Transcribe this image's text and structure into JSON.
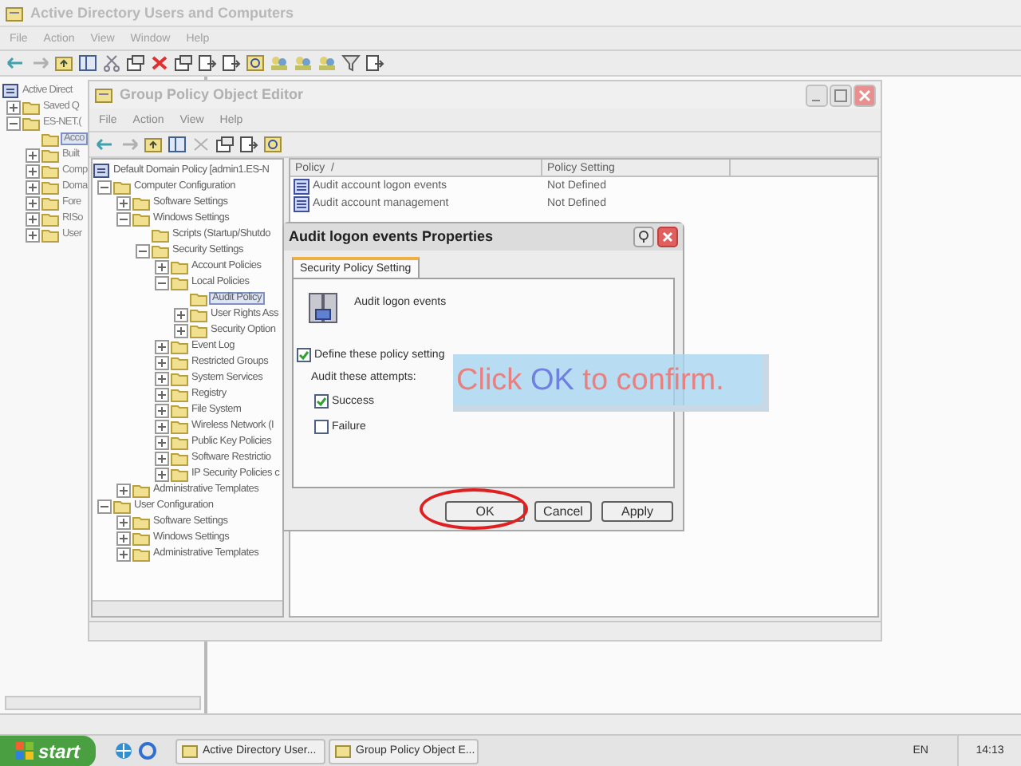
{
  "aduc": {
    "title": "Active Directory Users and Computers",
    "menu": [
      "File",
      "Action",
      "View",
      "Window",
      "Help"
    ],
    "tree": [
      {
        "label": "Active Direct",
        "kind": "root",
        "selected": false,
        "children": [
          {
            "label": "Saved Q",
            "kind": "collapsed",
            "selected": false
          },
          {
            "label": "ES-NET.(",
            "kind": "expanded",
            "selected": false,
            "children": [
              {
                "label": "Acco",
                "kind": "leaf",
                "selected": true
              },
              {
                "label": "Built",
                "kind": "collapsed",
                "selected": false
              },
              {
                "label": "Comp",
                "kind": "collapsed",
                "selected": false
              },
              {
                "label": "Doma",
                "kind": "collapsed",
                "selected": false
              },
              {
                "label": "Fore",
                "kind": "collapsed",
                "selected": false
              },
              {
                "label": "RISo",
                "kind": "collapsed",
                "selected": false
              },
              {
                "label": "User",
                "kind": "collapsed",
                "selected": false
              }
            ]
          }
        ]
      }
    ]
  },
  "gpo": {
    "title": "Group Policy Object Editor",
    "menu": [
      "File",
      "Action",
      "View",
      "Help"
    ],
    "tree": [
      {
        "label": "Default Domain Policy [admin1.ES-N",
        "kind": "root",
        "selected": false,
        "children": [
          {
            "label": "Computer Configuration",
            "kind": "expanded",
            "selected": false,
            "children": [
              {
                "label": "Software Settings",
                "kind": "collapsed",
                "selected": false
              },
              {
                "label": "Windows Settings",
                "kind": "expanded",
                "selected": false,
                "children": [
                  {
                    "label": "Scripts (Startup/Shutdo",
                    "kind": "leaf",
                    "selected": false
                  },
                  {
                    "label": "Security Settings",
                    "kind": "expanded",
                    "selected": false,
                    "children": [
                      {
                        "label": "Account Policies",
                        "kind": "collapsed",
                        "selected": false
                      },
                      {
                        "label": "Local Policies",
                        "kind": "expanded",
                        "selected": false,
                        "children": [
                          {
                            "label": "Audit Policy",
                            "kind": "leaf",
                            "selected": true
                          },
                          {
                            "label": "User Rights Ass",
                            "kind": "collapsed",
                            "selected": false
                          },
                          {
                            "label": "Security Option",
                            "kind": "collapsed",
                            "selected": false
                          }
                        ]
                      },
                      {
                        "label": "Event Log",
                        "kind": "collapsed",
                        "selected": false
                      },
                      {
                        "label": "Restricted Groups",
                        "kind": "collapsed",
                        "selected": false
                      },
                      {
                        "label": "System Services",
                        "kind": "collapsed",
                        "selected": false
                      },
                      {
                        "label": "Registry",
                        "kind": "collapsed",
                        "selected": false
                      },
                      {
                        "label": "File System",
                        "kind": "collapsed",
                        "selected": false
                      },
                      {
                        "label": "Wireless Network (I",
                        "kind": "collapsed",
                        "selected": false
                      },
                      {
                        "label": "Public Key Policies",
                        "kind": "collapsed",
                        "selected": false
                      },
                      {
                        "label": "Software Restrictio",
                        "kind": "collapsed",
                        "selected": false
                      },
                      {
                        "label": "IP Security Policies c",
                        "kind": "collapsed",
                        "selected": false
                      }
                    ]
                  }
                ]
              },
              {
                "label": "Administrative Templates",
                "kind": "collapsed",
                "selected": false
              }
            ]
          },
          {
            "label": "User Configuration",
            "kind": "expanded",
            "selected": false,
            "children": [
              {
                "label": "Software Settings",
                "kind": "collapsed",
                "selected": false
              },
              {
                "label": "Windows Settings",
                "kind": "collapsed",
                "selected": false
              },
              {
                "label": "Administrative Templates",
                "kind": "collapsed",
                "selected": false
              }
            ]
          }
        ]
      }
    ],
    "columns": [
      "Policy  /",
      "Policy Setting"
    ],
    "rows": [
      {
        "policy": "Audit account logon events",
        "setting": "Not Defined"
      },
      {
        "policy": "Audit account management",
        "setting": "Not Defined"
      }
    ]
  },
  "dialog": {
    "title": "Audit logon events Properties",
    "tab": "Security Policy Setting",
    "policy_name": "Audit logon events",
    "define": {
      "label": "Define these policy setting",
      "checked": true
    },
    "attempts_label": "Audit these attempts:",
    "options": [
      {
        "label": "Success",
        "checked": true
      },
      {
        "label": "Failure",
        "checked": false
      }
    ],
    "buttons": [
      "OK",
      "Cancel",
      "Apply"
    ]
  },
  "callout": {
    "parts": [
      {
        "text": "Click",
        "color": "#e88080"
      },
      {
        "text": "OK",
        "color": "#7080e0"
      },
      {
        "text": "to confirm.",
        "color": "#e88080"
      }
    ]
  },
  "taskbar": {
    "start": "start",
    "tasks": [
      "Active Directory User...",
      "Group Policy Object E..."
    ],
    "language": "EN",
    "clock": "14:13"
  }
}
